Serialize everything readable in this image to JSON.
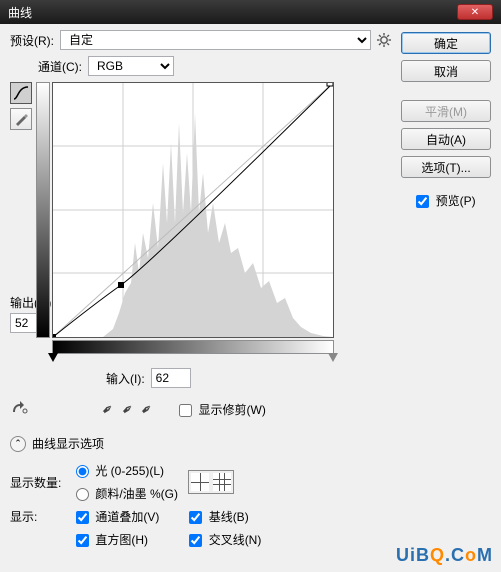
{
  "window": {
    "title": "曲线"
  },
  "preset": {
    "label": "预设(R):",
    "value": "自定"
  },
  "channel": {
    "label": "通道(C):",
    "value": "RGB"
  },
  "output": {
    "label": "输出(O):",
    "value": "52"
  },
  "input": {
    "label": "输入(I):",
    "value": "62"
  },
  "showClipping": {
    "label": "显示修剪(W)",
    "checked": false
  },
  "curveOptionsHeader": "曲线显示选项",
  "displayAmount": {
    "label": "显示数量:",
    "light": "光 (0-255)(L)",
    "pigment": "颜料/油墨 %(G)",
    "selected": "light"
  },
  "show": {
    "label": "显示:",
    "channelOverlay": {
      "label": "通道叠加(V)",
      "checked": true
    },
    "baseline": {
      "label": "基线(B)",
      "checked": true
    },
    "histogram": {
      "label": "直方图(H)",
      "checked": true
    },
    "intersection": {
      "label": "交叉线(N)",
      "checked": true
    }
  },
  "buttons": {
    "ok": "确定",
    "cancel": "取消",
    "smooth": "平滑(M)",
    "auto": "自动(A)",
    "options": "选项(T)..."
  },
  "preview": {
    "label": "预览(P)",
    "checked": true
  },
  "watermark": "UiBQ.CoM",
  "chart_data": {
    "type": "line",
    "title": "",
    "xlabel": "输入",
    "ylabel": "输出",
    "xlim": [
      0,
      255
    ],
    "ylim": [
      0,
      255
    ],
    "series": [
      {
        "name": "curve",
        "x": [
          0,
          62,
          255
        ],
        "y": [
          0,
          52,
          255
        ]
      },
      {
        "name": "baseline",
        "x": [
          0,
          255
        ],
        "y": [
          0,
          255
        ]
      }
    ],
    "control_points": [
      {
        "x": 0,
        "y": 0
      },
      {
        "x": 62,
        "y": 52
      },
      {
        "x": 255,
        "y": 255
      }
    ],
    "histogram_peaks_x": [
      70,
      90,
      110,
      125,
      140,
      160,
      180,
      200,
      220
    ],
    "histogram_peak_note": "dense mound roughly between x=60 and x=240 with tall spikes near 110-160"
  }
}
